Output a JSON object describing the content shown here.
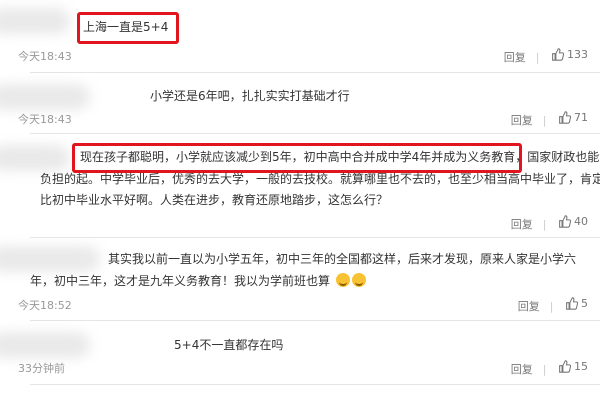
{
  "comments": [
    {
      "lines": [
        "上海一直是5+4"
      ],
      "time": "今天18:43",
      "reply": "回复",
      "likes": "133"
    },
    {
      "lines": [
        "小学还是6年吧，扎扎实实打基础才行"
      ],
      "time": "今天18:43",
      "reply": "回复",
      "likes": "71"
    },
    {
      "lines": [
        "现在孩子都聪明，小学就应该减少到5年，初中高中合并成中学4年并成为义务教育，国家财政也能",
        "负担的起。中学毕业后，优秀的去大学，一般的去技校。就算哪里也不去的，也至少相当高中毕业了，肯定",
        "比初中毕业水平好啊。人类在进步，教育还原地踏步，这怎么行？"
      ],
      "time": "",
      "reply": "回复",
      "likes": "40"
    },
    {
      "lines": [
        "其实我以前一直以为小学五年，初中三年的全国都这样，后来才发现，原来人家是小学六",
        "年，初中三年，这才是九年义务教育！我以为学前班也算"
      ],
      "time": "今天18:52",
      "reply": "回复",
      "likes": "5"
    },
    {
      "lines": [
        "5+4不一直都存在吗"
      ],
      "time": "33分钟前",
      "reply": "回复",
      "likes": "15"
    }
  ],
  "colors": {
    "highlight": "#e0151d",
    "muted": "#999999",
    "text": "#333333"
  },
  "icons": {
    "like": "thumbs-up-icon",
    "emoji": "laughing-emoji-icon"
  }
}
